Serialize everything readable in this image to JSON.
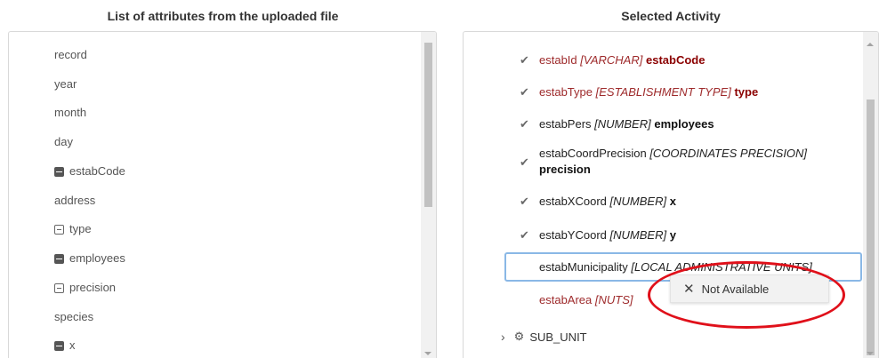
{
  "left_header": "List of attributes from the uploaded file",
  "right_header": "Selected Activity",
  "attributes": [
    {
      "label": "record",
      "icon": "none"
    },
    {
      "label": "year",
      "icon": "none"
    },
    {
      "label": "month",
      "icon": "none"
    },
    {
      "label": "day",
      "icon": "none"
    },
    {
      "label": "estabCode",
      "icon": "filled-minus"
    },
    {
      "label": "address",
      "icon": "none"
    },
    {
      "label": "type",
      "icon": "outline-minus"
    },
    {
      "label": "employees",
      "icon": "filled-minus"
    },
    {
      "label": "precision",
      "icon": "outline-minus"
    },
    {
      "label": "species",
      "icon": "none"
    },
    {
      "label": "x",
      "icon": "filled-minus"
    }
  ],
  "activity_items": [
    {
      "name": "estabId",
      "type": "[VARCHAR]",
      "value": "estabCode",
      "color": "#9e2a2b",
      "checked": true
    },
    {
      "name": "estabType",
      "type": "[ESTABLISHMENT TYPE]",
      "value": "type",
      "color": "#9e2a2b",
      "checked": true
    },
    {
      "name": "estabPers",
      "type": "[NUMBER]",
      "value": "employees",
      "color": "#222222",
      "checked": true
    },
    {
      "name": "estabCoordPrecision",
      "type": "[COORDINATES PRECISION]",
      "value": "precision",
      "color": "#222222",
      "checked": true
    },
    {
      "name": "estabXCoord",
      "type": "[NUMBER]",
      "value": "x",
      "color": "#222222",
      "checked": true
    },
    {
      "name": "estabYCoord",
      "type": "[NUMBER]",
      "value": "y",
      "color": "#222222",
      "checked": true
    }
  ],
  "active_item": {
    "name": "estabMunicipality",
    "type": "[LOCAL ADMINISTRATIVE UNITS]"
  },
  "area_item": {
    "name": "estabArea",
    "type": "[NUTS]"
  },
  "dropdown": {
    "icon": "close-icon",
    "label": "Not Available"
  },
  "subunit": {
    "label": "SUB_UNIT",
    "icon": "gear-icon"
  },
  "colors": {
    "required": "#9e2a2b",
    "focus_border": "#8ab8e6",
    "highlight_ellipse": "#e0101a"
  }
}
